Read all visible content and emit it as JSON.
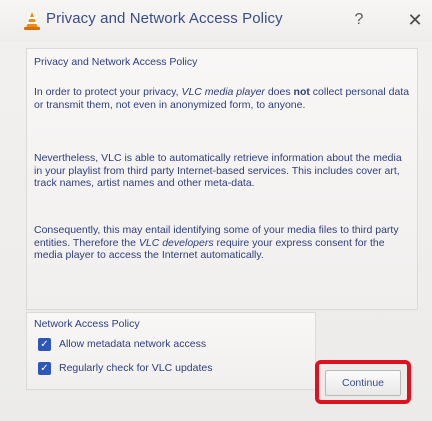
{
  "window": {
    "title": "Privacy and Network Access Policy",
    "help_label": "?",
    "close_label": "✕",
    "icon": "vlc-cone-icon"
  },
  "privacy": {
    "section_title": "Privacy and Network Access Policy",
    "p1_prefix": "In order to protect your privacy, ",
    "p1_em": "VLC media player",
    "p1_mid": " does ",
    "p1_bold": "not",
    "p1_suffix": " collect personal data or transmit them, not even in anonymized form, to anyone.",
    "p2": "Nevertheless, VLC is able to automatically retrieve information about the media in your playlist from third party Internet-based services. This includes cover art, track names, artist names and other meta-data.",
    "p3_prefix": "Consequently, this may entail identifying some of your media files to third party entities. Therefore the ",
    "p3_em": "VLC developers",
    "p3_suffix": " require your express consent for the media player to access the Internet automatically."
  },
  "network": {
    "section_title": "Network Access Policy",
    "options": [
      {
        "label": "Allow metadata network access",
        "checked": true
      },
      {
        "label": "Regularly check for VLC updates",
        "checked": true
      }
    ]
  },
  "buttons": {
    "continue_label": "Continue"
  },
  "colors": {
    "text": "#2e3f7e",
    "checkbox": "#2c56b8",
    "highlight": "#e0101c"
  }
}
